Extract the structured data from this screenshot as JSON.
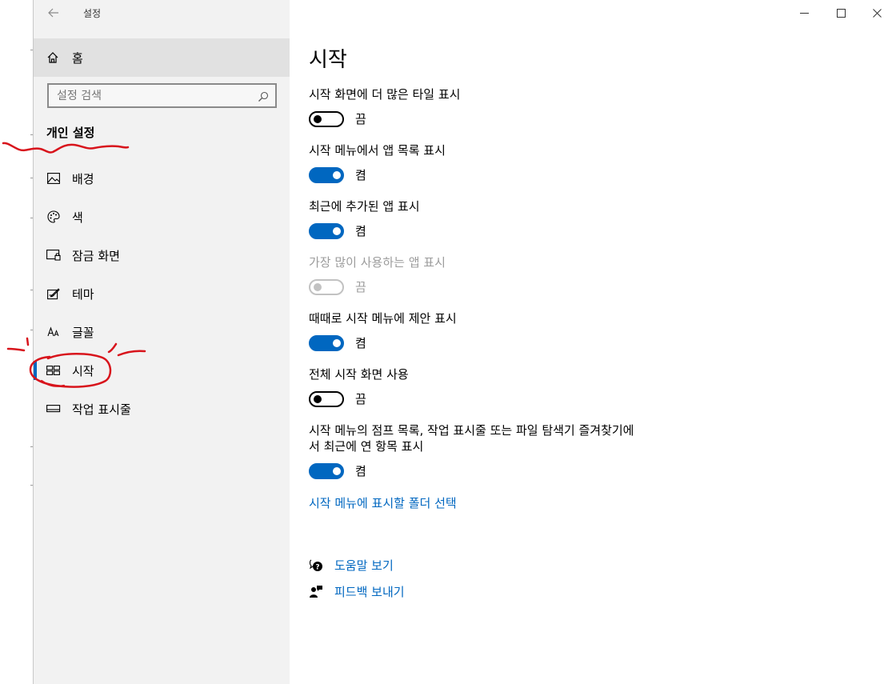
{
  "app": {
    "title": "설정"
  },
  "sidebar": {
    "home_label": "홈",
    "search_placeholder": "설정 검색",
    "section_title": "개인 설정",
    "items": [
      {
        "label": "배경",
        "icon": "picture-icon"
      },
      {
        "label": "색",
        "icon": "palette-icon"
      },
      {
        "label": "잠금 화면",
        "icon": "lock-screen-icon"
      },
      {
        "label": "테마",
        "icon": "theme-icon"
      },
      {
        "label": "글꼴",
        "icon": "font-icon"
      },
      {
        "label": "시작",
        "icon": "start-icon",
        "active": true
      },
      {
        "label": "작업 표시줄",
        "icon": "taskbar-icon"
      }
    ]
  },
  "main": {
    "title": "시작",
    "settings": [
      {
        "label": "시작 화면에 더 많은 타일 표시",
        "state": "끔",
        "on": false,
        "disabled": false
      },
      {
        "label": "시작 메뉴에서 앱 목록 표시",
        "state": "켬",
        "on": true,
        "disabled": false
      },
      {
        "label": "최근에 추가된 앱 표시",
        "state": "켬",
        "on": true,
        "disabled": false
      },
      {
        "label": "가장 많이 사용하는 앱 표시",
        "state": "끔",
        "on": false,
        "disabled": true
      },
      {
        "label": "때때로 시작 메뉴에 제안 표시",
        "state": "켬",
        "on": true,
        "disabled": false
      },
      {
        "label": "전체 시작 화면 사용",
        "state": "끔",
        "on": false,
        "disabled": false
      },
      {
        "label_line1": "시작 메뉴의 점프 목록, 작업 표시줄 또는 파일 탐색기 즐겨찾기에",
        "label_line2": "서 최근에 연 항목 표시",
        "state": "켬",
        "on": true,
        "disabled": false
      }
    ],
    "folder_link": "시작 메뉴에 표시할 폴더 선택",
    "help_label": "도움말 보기",
    "feedback_label": "피드백 보내기"
  },
  "colors": {
    "accent": "#0067c0",
    "sidebar_bg": "#f2f2f2",
    "annotation": "#d8141c"
  }
}
